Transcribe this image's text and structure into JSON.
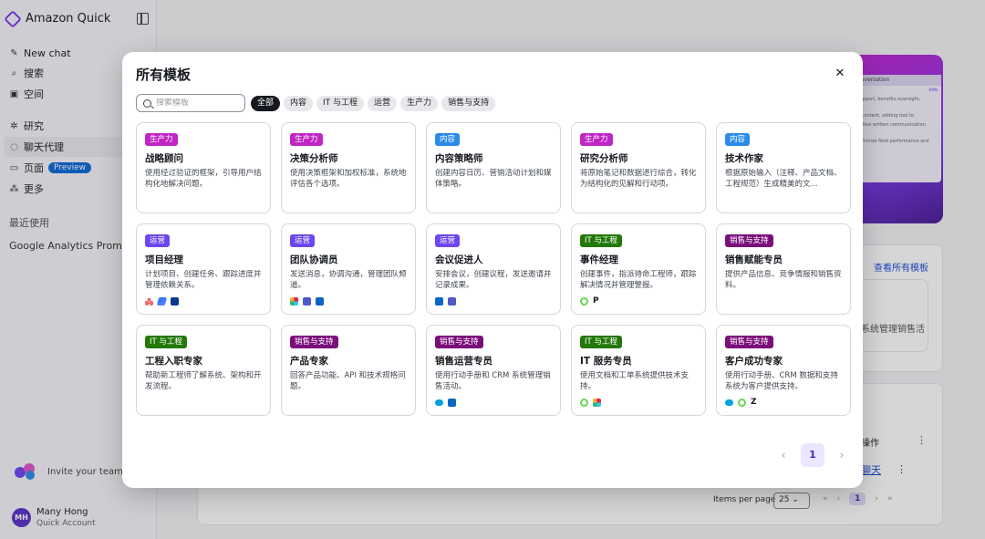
{
  "sidebar": {
    "brand": "Amazon Quick",
    "nav": [
      {
        "label": "New chat",
        "icon": "edit-icon"
      },
      {
        "label": "搜索",
        "icon": "search-icon"
      },
      {
        "label": "空间",
        "icon": "spaces-icon"
      },
      {
        "label": "研究",
        "icon": "research-icon"
      },
      {
        "label": "聊天代理",
        "icon": "chat-agent-icon"
      },
      {
        "label": "页面",
        "icon": "pages-icon",
        "badge": "Preview"
      },
      {
        "label": "更多",
        "icon": "more-icon"
      }
    ],
    "recent_label": "最近使用",
    "recent_items": [
      "Google Analytics Prompt E"
    ],
    "invite_label": "Invite your team",
    "user": {
      "initials": "MH",
      "name": "Many Hong",
      "account": "Quick Account"
    }
  },
  "background": {
    "hero_card_title": "onversation",
    "hero_card_lines": [
      "Info",
      "support, benefits oversight,",
      "g content, editing tool to",
      "ective written communication.",
      "optimize field performance and"
    ],
    "view_all_link": "查看所有模板",
    "panel_text_1": "系统管理销售活",
    "panel_text_2": "操作",
    "panel_link": "聊天",
    "items_per_page_label": "Items per page",
    "items_per_page_value": "25",
    "page_current": "1"
  },
  "modal": {
    "title": "所有模板",
    "search_placeholder": "搜索模板",
    "filters": [
      "全部",
      "内容",
      "IT 与工程",
      "运营",
      "生产力",
      "销售与支持"
    ],
    "active_filter": "全部",
    "tag_colors": {
      "生产力": "#c026c4",
      "内容": "#2b8be8",
      "运营": "#6d46f0",
      "IT 与工程": "#23780a",
      "销售与支持": "#7a0e7a"
    },
    "cards": [
      {
        "tag": "生产力",
        "title": "战略顾问",
        "desc": "使用经过验证的框架，引导用户结构化地解决问题。",
        "icons": []
      },
      {
        "tag": "生产力",
        "title": "决策分析师",
        "desc": "使用决策框架和加权标准，系统地评估各个选项。",
        "icons": []
      },
      {
        "tag": "内容",
        "title": "内容策略师",
        "desc": "创建内容日历、营销活动计划和媒体策略。",
        "icons": []
      },
      {
        "tag": "生产力",
        "title": "研究分析师",
        "desc": "将原始笔记和数据进行综合，转化为结构化的见解和行动项。",
        "icons": []
      },
      {
        "tag": "内容",
        "title": "技术作家",
        "desc": "根据原始输入（注释、产品文档、工程规范）生成精美的文...",
        "icons": []
      },
      {
        "tag": "运营",
        "title": "项目经理",
        "desc": "计划项目、创建任务、跟踪进度并管理依赖关系。",
        "icons": [
          "asana-icon",
          "linear-icon",
          "jira-icon"
        ]
      },
      {
        "tag": "运营",
        "title": "团队协调员",
        "desc": "发送消息，协调沟通，管理团队频道。",
        "icons": [
          "slack-icon",
          "teams-icon",
          "outlook-icon"
        ]
      },
      {
        "tag": "运营",
        "title": "会议促进人",
        "desc": "安排会议，创建议程，发送邀请并记录成果。",
        "icons": [
          "outlook-icon",
          "teams-icon"
        ]
      },
      {
        "tag": "IT 与工程",
        "title": "事件经理",
        "desc": "创建事件，指派待命工程师，跟踪解决情况并管理警报。",
        "icons": [
          "servicenow-icon",
          "pagerduty-icon"
        ]
      },
      {
        "tag": "销售与支持",
        "title": "销售赋能专员",
        "desc": "提供产品信息、竞争情报和销售资料。",
        "icons": []
      },
      {
        "tag": "IT 与工程",
        "title": "工程入职专家",
        "desc": "帮助新工程师了解系统、架构和开发流程。",
        "icons": []
      },
      {
        "tag": "销售与支持",
        "title": "产品专家",
        "desc": "回答产品功能、API 和技术规格问题。",
        "icons": []
      },
      {
        "tag": "销售与支持",
        "title": "销售运营专员",
        "desc": "使用行动手册和 CRM 系统管理销售活动。",
        "icons": [
          "salesforce-icon",
          "outlook-icon"
        ]
      },
      {
        "tag": "IT 与工程",
        "title": "IT 服务专员",
        "desc": "使用文档和工单系统提供技术支持。",
        "icons": [
          "servicenow-icon",
          "slack-icon"
        ]
      },
      {
        "tag": "销售与支持",
        "title": "客户成功专家",
        "desc": "使用行动手册、CRM 数据和支持系统为客户提供支持。",
        "icons": [
          "salesforce-icon",
          "servicenow-icon",
          "zendesk-icon"
        ]
      }
    ],
    "pagination": {
      "current": "1",
      "prev_icon": "chevron-left-icon",
      "next_icon": "chevron-right-icon"
    }
  }
}
